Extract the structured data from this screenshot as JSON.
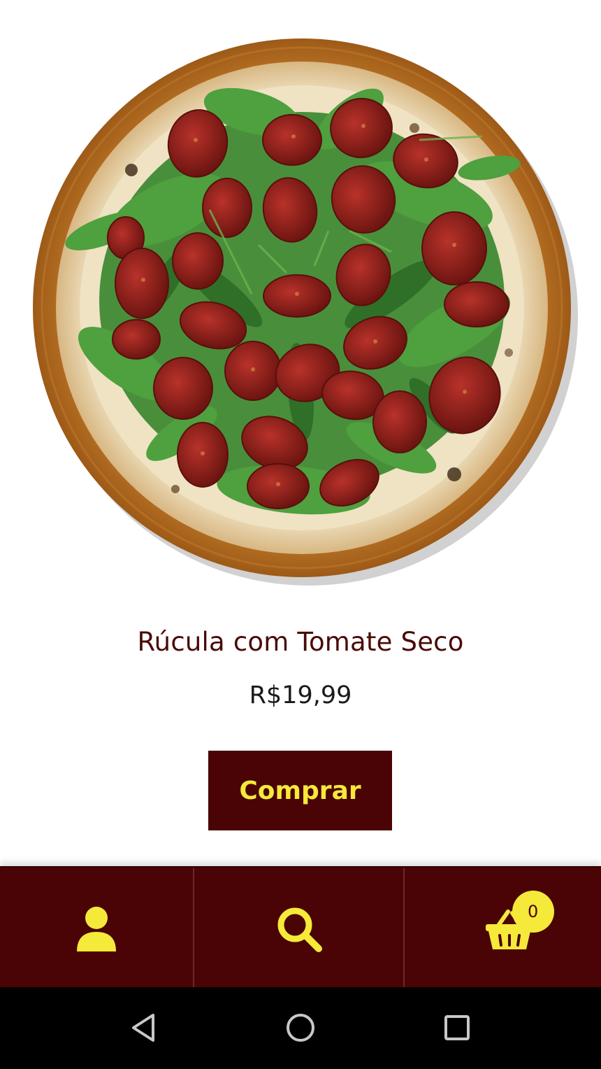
{
  "product": {
    "name": "Rúcula com Tomate Seco",
    "price": "R$19,99",
    "buy_label": "Comprar",
    "image_icon": "pizza-image"
  },
  "bottom_nav": {
    "items": [
      {
        "icon": "user-icon"
      },
      {
        "icon": "search-icon"
      },
      {
        "icon": "basket-icon"
      }
    ],
    "cart_count": "0"
  },
  "system_nav": {
    "items": [
      {
        "icon": "back-icon"
      },
      {
        "icon": "home-icon"
      },
      {
        "icon": "recents-icon"
      }
    ]
  },
  "colors": {
    "brand": "#4a0405",
    "accent": "#f5e93a",
    "title": "#4a0a08"
  }
}
